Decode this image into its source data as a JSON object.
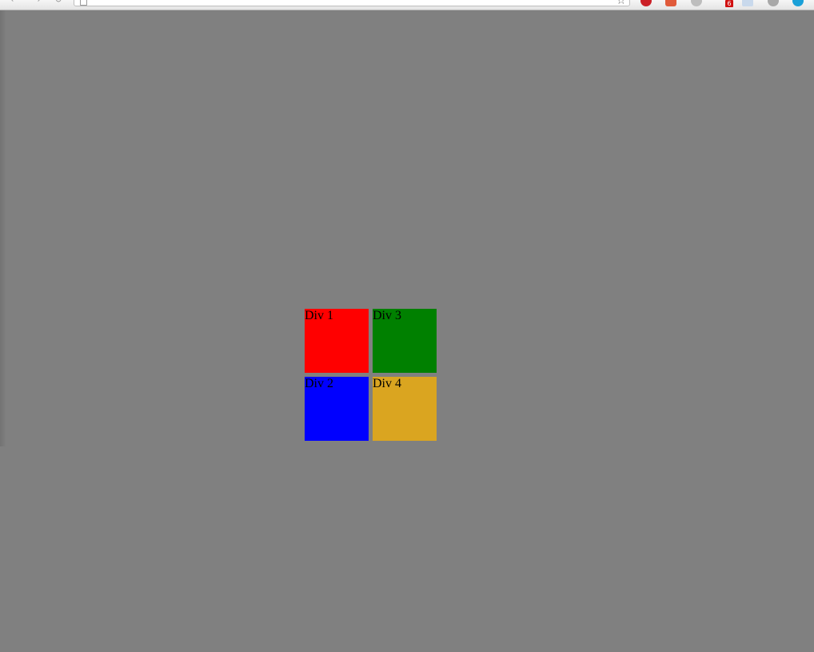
{
  "browser": {
    "url": "",
    "bookmark_icon": "star-icon",
    "extensions": [
      {
        "icon": "pinterest-icon",
        "color": "#cb2027"
      },
      {
        "icon": "extension-icon",
        "color": "#e05a3a"
      },
      {
        "icon": "extension-icon",
        "color": "#bdbdbd"
      },
      {
        "icon": "extension-icon",
        "color": "#c9d9ec"
      },
      {
        "icon": "extension-icon",
        "color": "#a8a8a8"
      },
      {
        "icon": "extension-icon",
        "color": "#1aa0d8"
      }
    ],
    "badge_count": "6",
    "badge_color": "#d01010"
  },
  "page": {
    "background_color": "#808080",
    "boxes": [
      {
        "label": "Div 1",
        "color": "#ff0000"
      },
      {
        "label": "Div 2",
        "color": "#0000ff"
      },
      {
        "label": "Div 3",
        "color": "#008000"
      },
      {
        "label": "Div 4",
        "color": "#daa520"
      }
    ]
  }
}
